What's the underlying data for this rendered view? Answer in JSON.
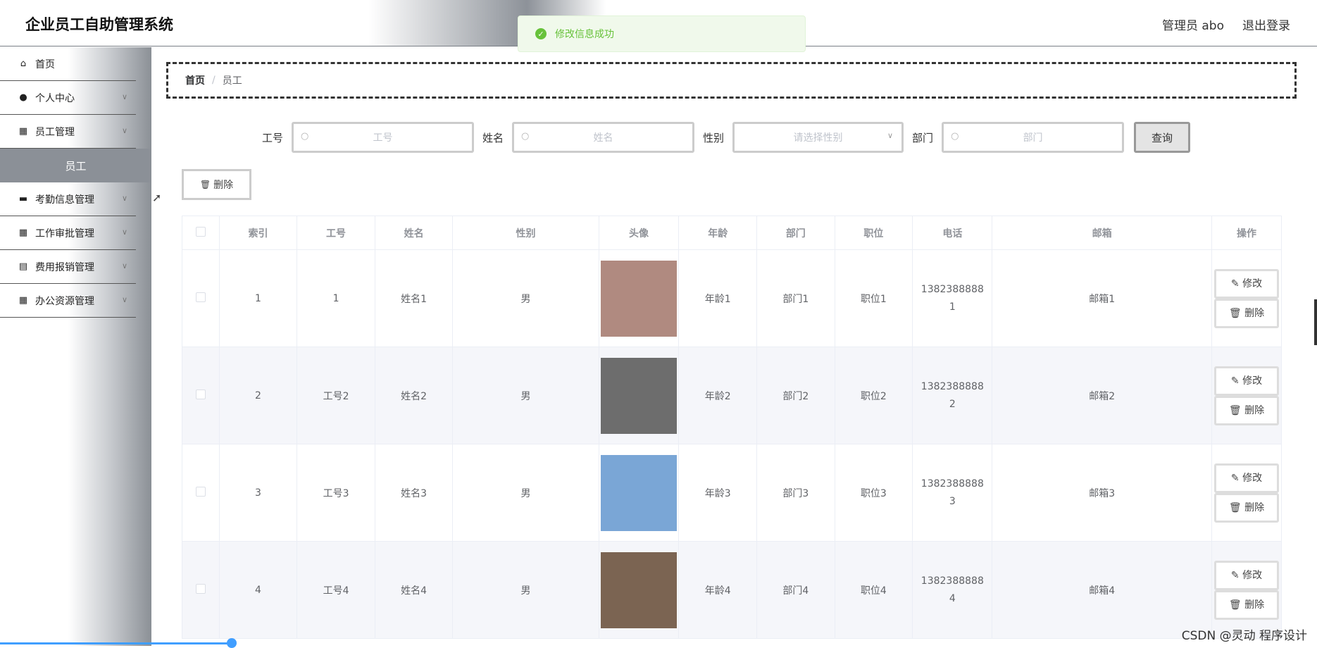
{
  "header": {
    "title": "企业员工自助管理系统",
    "user": "管理员 abo",
    "logout": "退出登录"
  },
  "toast": {
    "text": "修改信息成功"
  },
  "sidebar": {
    "items": [
      {
        "label": "首页",
        "icon": "home-icon",
        "glyph": "⌂",
        "chevron": false
      },
      {
        "label": "个人中心",
        "icon": "user-icon",
        "glyph": "●",
        "chevron": true
      },
      {
        "label": "员工管理",
        "icon": "grid-icon",
        "glyph": "▦",
        "chevron": true
      },
      {
        "label": "考勤信息管理",
        "icon": "briefcase-icon",
        "glyph": "▬",
        "chevron": true
      },
      {
        "label": "工作审批管理",
        "icon": "grid-icon",
        "glyph": "▦",
        "chevron": true
      },
      {
        "label": "费用报销管理",
        "icon": "clipboard-icon",
        "glyph": "▤",
        "chevron": true
      },
      {
        "label": "办公资源管理",
        "icon": "grid-icon",
        "glyph": "▦",
        "chevron": true
      }
    ],
    "active_sub": "员工"
  },
  "breadcrumb": {
    "home": "首页",
    "sep": "/",
    "current": "员工"
  },
  "search": {
    "gonghao_label": "工号",
    "gonghao_ph": "工号",
    "name_label": "姓名",
    "name_ph": "姓名",
    "gender_label": "性别",
    "gender_ph": "请选择性别",
    "dept_label": "部门",
    "dept_ph": "部门",
    "query": "查询"
  },
  "bulk_delete": "删除",
  "table": {
    "headers": [
      "索引",
      "工号",
      "姓名",
      "性别",
      "头像",
      "年龄",
      "部门",
      "职位",
      "电话",
      "邮箱",
      "操作"
    ],
    "rows": [
      {
        "idx": "1",
        "gonghao": "1",
        "name": "姓名1",
        "gender": "男",
        "age": "年龄1",
        "dept": "部门1",
        "pos": "职位1",
        "phone": "13823888881",
        "email": "邮箱1",
        "avatar_color": "#b08a80"
      },
      {
        "idx": "2",
        "gonghao": "工号2",
        "name": "姓名2",
        "gender": "男",
        "age": "年龄2",
        "dept": "部门2",
        "pos": "职位2",
        "phone": "13823888882",
        "email": "邮箱2",
        "avatar_color": "#6d6d6d"
      },
      {
        "idx": "3",
        "gonghao": "工号3",
        "name": "姓名3",
        "gender": "男",
        "age": "年龄3",
        "dept": "部门3",
        "pos": "职位3",
        "phone": "13823888883",
        "email": "邮箱3",
        "avatar_color": "#7aa6d6"
      },
      {
        "idx": "4",
        "gonghao": "工号4",
        "name": "姓名4",
        "gender": "男",
        "age": "年龄4",
        "dept": "部门4",
        "pos": "职位4",
        "phone": "13823888884",
        "email": "邮箱4",
        "avatar_color": "#7b6452"
      }
    ],
    "edit_label": "修改",
    "delete_label": "删除"
  },
  "watermark": "CSDN @灵动 程序设计"
}
